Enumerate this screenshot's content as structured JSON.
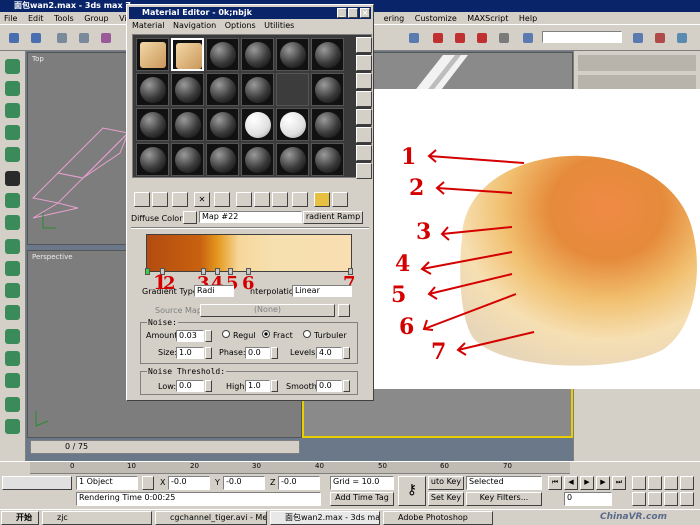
{
  "app": {
    "title": "面包wan2.max - 3ds max 7 -",
    "menu": [
      "File",
      "Edit",
      "Tools",
      "Group",
      "Views",
      "G",
      "ering",
      "Customize",
      "MAXScript",
      "Help"
    ]
  },
  "viewports": {
    "top_label": "Top",
    "perspective_label": "Perspective"
  },
  "material_editor": {
    "title": "Material Editor - 0k;nbjk",
    "menu": [
      "Material",
      "Navigation",
      "Options",
      "Utilities"
    ],
    "diffuse_label": "Diffuse Color:",
    "map_name": "Map #22",
    "map_type": "radient Ramp",
    "gradient_type_label": "Gradient Type:",
    "gradient_type_value": "Radi",
    "interpolation_label": "nterpolation:",
    "interpolation_value": "Linear",
    "source_map_label": "Source Map:",
    "source_map_value": "(None)",
    "noise_header": "Noise:",
    "amount_label": "Amount:",
    "amount_value": "0.03",
    "radio_regular": "Regul",
    "radio_fractal": "Fract",
    "radio_turbulence": "Turbuler",
    "size_label": "Size:",
    "size_value": "1.0",
    "phase_label": "Phase:",
    "phase_value": "0.0",
    "levels_label": "Levels:",
    "levels_value": "4.0",
    "threshold_header": "Noise Threshold:",
    "low_label": "Low:",
    "low_value": "0.0",
    "high_label": "High:",
    "high_value": "1.0",
    "smooth_label": "Smooth:",
    "smooth_value": "0.0",
    "gradient_colors": [
      "#b34c10",
      "#c8610f",
      "#e59b20",
      "#f6d79b",
      "#f6e0b0",
      "#f8deb0"
    ],
    "under_flag_numbers": [
      "1",
      "2",
      "3",
      "4",
      "5",
      "6",
      "7"
    ]
  },
  "annotation_numbers": [
    "1",
    "2",
    "3",
    "4",
    "5",
    "6",
    "7"
  ],
  "timeline": {
    "frame": "0 / 75",
    "ticks": [
      "0",
      "10",
      "20",
      "30",
      "40",
      "50",
      "60",
      "70"
    ]
  },
  "statusbar": {
    "objects": "1 Object",
    "x_label": "X",
    "x_value": "-0.0",
    "y_label": "Y",
    "y_value": "-0.0",
    "z_label": "Z",
    "z_value": "-0.0",
    "grid": "Grid = 10.0",
    "rendering_time": "Rendering Time  0:00:25",
    "add_time_tag": "Add Time Tag",
    "auto_key": "uto Key",
    "set_key": "Set Key",
    "selected": "Selected",
    "key_filters": "Key Filters...",
    "frame_field": "0"
  },
  "taskbar": {
    "start": "开始",
    "items": [
      "zjc",
      "cgchannel_tiger.avi - Med...",
      "面包wan2.max - 3ds max...",
      "Adobe Photoshop"
    ],
    "tray": "ChinaVR.com"
  },
  "accent": {
    "title_blue": "#0a246a",
    "annotation_red": "#d40000",
    "ui_gray": "#d4d0c8"
  }
}
